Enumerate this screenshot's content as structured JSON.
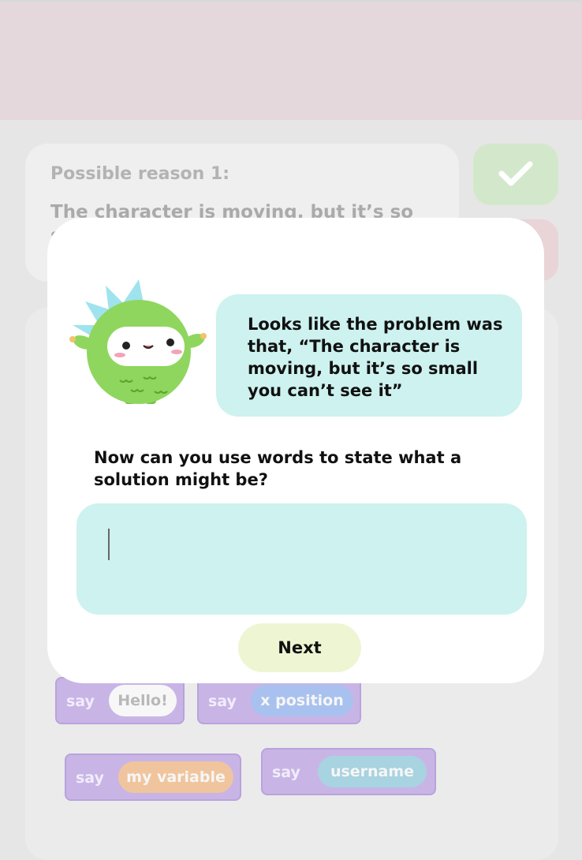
{
  "background": {
    "reason_title": "Possible reason 1:",
    "reason_text": "The character is moving, but it’s so s",
    "check_icon": "check-icon",
    "blocks": [
      {
        "say": "say",
        "value": "Hello!"
      },
      {
        "say": "say",
        "value": "x position"
      },
      {
        "say": "say",
        "value": "my variable"
      },
      {
        "say": "say",
        "value": "username"
      }
    ]
  },
  "modal": {
    "mascot": "green-monster-mascot",
    "bubble_text": "Looks like the problem was that, “The character is moving, but it’s so small you can’t see it”",
    "prompt": "Now can you use words to state what a solution might be?",
    "answer_value": "",
    "next_label": "Next"
  },
  "colors": {
    "teal_bubble": "#cdf2ef",
    "next_button": "#eef5d3",
    "block_purple": "#c8b5e6",
    "mascot_green": "#8fd65e"
  }
}
